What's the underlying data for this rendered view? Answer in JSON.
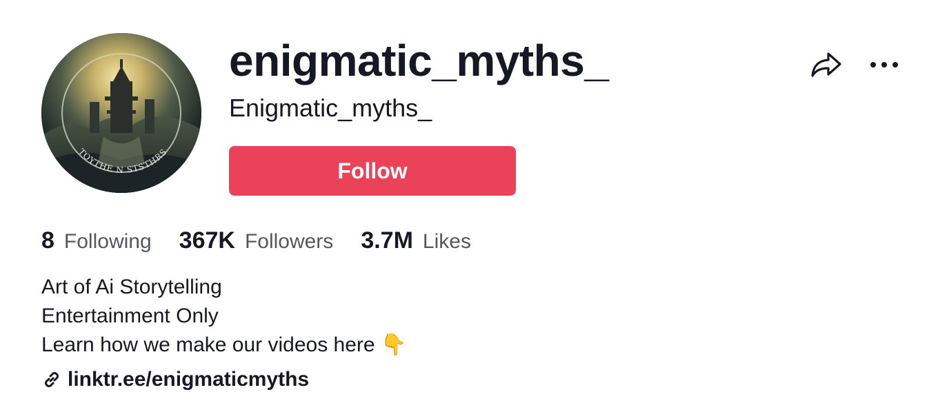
{
  "profile": {
    "username": "enigmatic_myths_",
    "nickname": "Enigmatic_myths_",
    "avatar_caption": "TOYTHE N STSTHRS",
    "follow_label": "Follow"
  },
  "actions": {
    "share_icon": "share-arrow-icon",
    "more_icon": "ellipsis-icon"
  },
  "stats": {
    "following": {
      "count": "8",
      "label": "Following"
    },
    "followers": {
      "count": "367K",
      "label": "Followers"
    },
    "likes": {
      "count": "3.7M",
      "label": "Likes"
    }
  },
  "bio": {
    "line1": "Art of Ai Storytelling",
    "line2": "Entertainment Only",
    "line3": "Learn how we make our videos here 👇"
  },
  "link": {
    "icon": "link-icon",
    "text": "linktr.ee/enigmaticmyths"
  },
  "colors": {
    "follow_button": "#ea4359",
    "primary_text": "#161823",
    "secondary_text": "#545664"
  }
}
